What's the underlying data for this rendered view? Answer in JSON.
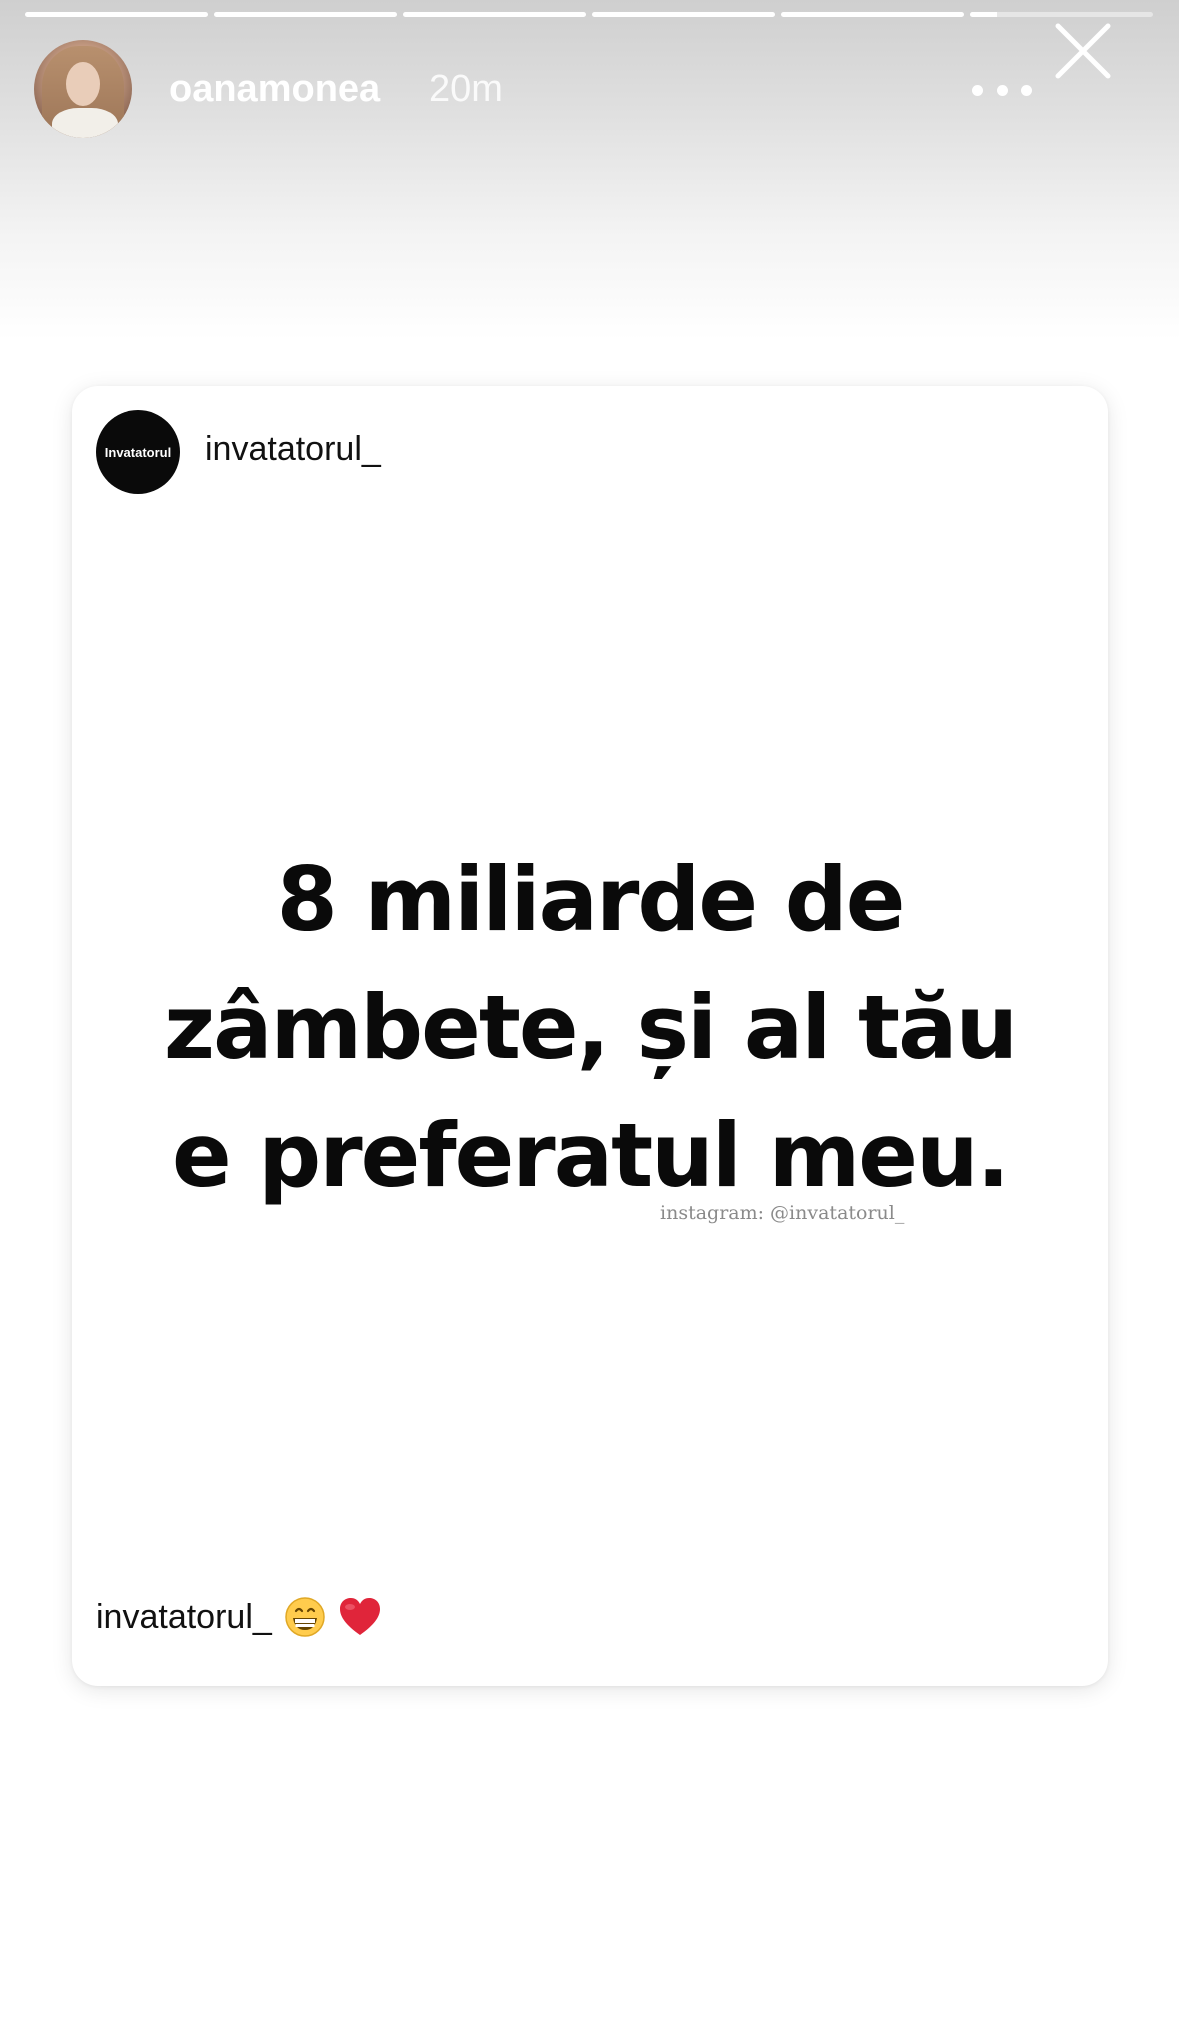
{
  "story": {
    "progress": [
      1,
      1,
      1,
      1,
      1,
      0.15
    ],
    "username": "oanamonea",
    "time_ago": "20m"
  },
  "icons": {
    "more": "more-horizontal-icon",
    "close": "close-icon"
  },
  "shared_post": {
    "author_avatar_text": "Invatatorul",
    "author": "invatatorul_",
    "quote_lines": [
      "8 miliarde de",
      "zâmbete, și al tău",
      "e preferatul meu."
    ],
    "watermark": "instagram: @invatatorul_",
    "caption_user": "invatatorul_",
    "caption_emojis": [
      "grinning-face",
      "red-heart"
    ]
  },
  "colors": {
    "header_text": "#ffffff",
    "quote_text": "#0a0a0a",
    "heart": "#e0253a"
  }
}
